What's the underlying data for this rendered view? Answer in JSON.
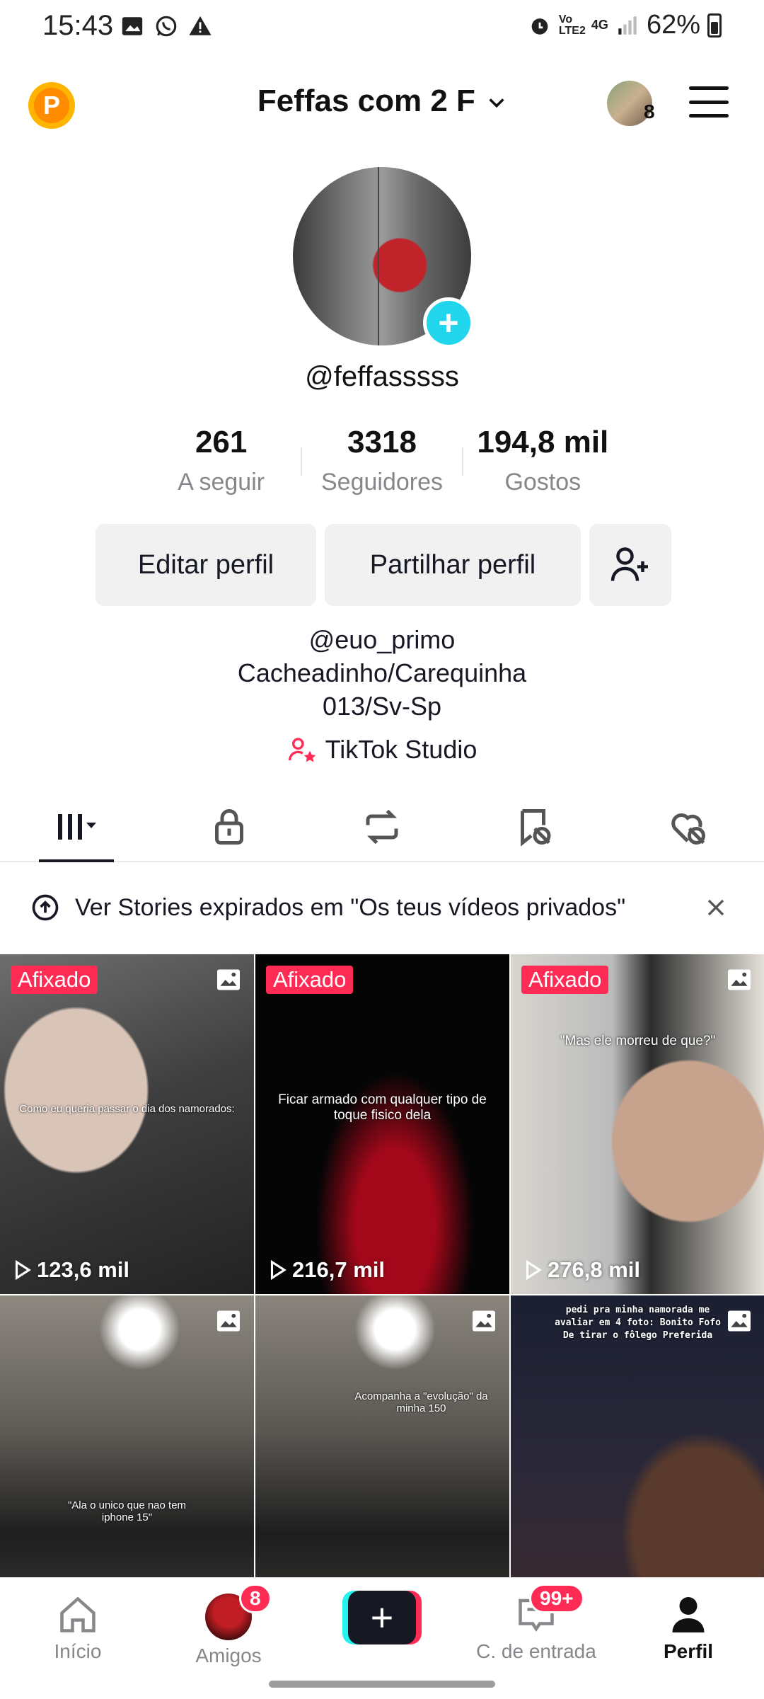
{
  "status_bar": {
    "time": "15:43",
    "battery": "62%",
    "network": "4G",
    "volte": "Vo LTE2"
  },
  "header": {
    "title": "Feffas com 2 F",
    "coin_letter": "P",
    "avatar_badge": "8"
  },
  "profile": {
    "username": "@feffasssss",
    "stats": [
      {
        "value": "261",
        "label": "A seguir"
      },
      {
        "value": "3318",
        "label": "Seguidores"
      },
      {
        "value": "194,8 mil",
        "label": "Gostos"
      }
    ],
    "edit_label": "Editar perfil",
    "share_label": "Partilhar perfil",
    "bio": [
      "@euo_primo",
      "Cacheadinho/Carequinha",
      "013/Sv-Sp"
    ],
    "studio_label": "TikTok Studio"
  },
  "tabs": [
    {
      "icon": "grid-icon",
      "active": true
    },
    {
      "icon": "lock-icon"
    },
    {
      "icon": "repost-icon"
    },
    {
      "icon": "saved-hidden-icon"
    },
    {
      "icon": "liked-hidden-icon"
    }
  ],
  "banner": {
    "text": "Ver Stories expirados em \"Os teus vídeos privados\""
  },
  "videos": [
    {
      "pinned": "Afixado",
      "views": "123,6 mil",
      "caption": "Como eu queria passar o dia dos namorados:"
    },
    {
      "pinned": "Afixado",
      "views": "216,7 mil",
      "caption": "Ficar armado com qualquer tipo de toque fisico dela"
    },
    {
      "pinned": "Afixado",
      "views": "276,8 mil",
      "caption": "\"Mas ele morreu de que?\""
    },
    {
      "pinned": "",
      "views": "",
      "caption": "\"Ala o unico que nao tem iphone 15\""
    },
    {
      "pinned": "",
      "views": "",
      "caption": "Acompanha a \"evolução\" da minha 150"
    },
    {
      "pinned": "",
      "views": "",
      "caption": "pedi pra minha namorada me avaliar em 4 foto: Bonito Fofo De tirar o fôlego Preferida"
    }
  ],
  "bottom_nav": {
    "home": "Início",
    "friends": "Amigos",
    "friends_badge": "8",
    "inbox": "C. de entrada",
    "inbox_badge": "99+",
    "profile": "Perfil"
  },
  "colors": {
    "accent_red": "#fe2c55",
    "accent_cyan": "#20d5ec",
    "coin": "#ffb400"
  }
}
